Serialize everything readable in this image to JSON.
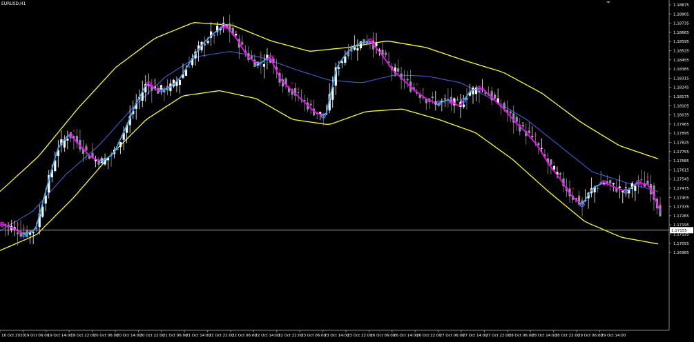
{
  "symbol": "EURUSD,H1",
  "current_price_label": "1.17155",
  "chart_data": {
    "type": "candlestick",
    "title": "EURUSD,H1",
    "timeframe": "H1",
    "y_ticks": [
      "1.18875",
      "1.18805",
      "1.18735",
      "1.18665",
      "1.18595",
      "1.18525",
      "1.18455",
      "1.18385",
      "1.18315",
      "1.18245",
      "1.18175",
      "1.18105",
      "1.18035",
      "1.17965",
      "1.17895",
      "1.17825",
      "1.17755",
      "1.17685",
      "1.17615",
      "1.17545",
      "1.17475",
      "1.17405",
      "1.17335",
      "1.17265",
      "1.17195",
      "1.17125",
      "1.17055",
      "1.16985"
    ],
    "x_ticks": [
      "16 Oct 2020",
      "19 Oct 06:00",
      "19 Oct 14:00",
      "19 Oct 22:00",
      "20 Oct 06:00",
      "20 Oct 14:00",
      "20 Oct 22:00",
      "21 Oct 06:00",
      "21 Oct 14:00",
      "21 Oct 22:00",
      "22 Oct 06:00",
      "22 Oct 14:00",
      "22 Oct 22:00",
      "23 Oct 06:00",
      "23 Oct 14:00",
      "23 Oct 22:00",
      "26 Oct 06:00",
      "26 Oct 14:00",
      "26 Oct 22:00",
      "27 Oct 06:00",
      "27 Oct 14:00",
      "27 Oct 22:00",
      "28 Oct 06:00",
      "28 Oct 14:00",
      "28 Oct 22:00",
      "29 Oct 06:00",
      "29 Oct 14:00"
    ],
    "ylim": [
      1.1695,
      1.189
    ],
    "current_price": 1.17155,
    "price_anchors": [
      1.172,
      1.1717,
      1.1712,
      1.1716,
      1.1748,
      1.1778,
      1.1789,
      1.178,
      1.1771,
      1.1768,
      1.1774,
      1.1792,
      1.1812,
      1.1828,
      1.1822,
      1.1824,
      1.1832,
      1.1846,
      1.1858,
      1.1866,
      1.1872,
      1.1862,
      1.1848,
      1.1842,
      1.1848,
      1.183,
      1.1822,
      1.1814,
      1.1806,
      1.1802,
      1.184,
      1.1852,
      1.1858,
      1.186,
      1.185,
      1.1838,
      1.183,
      1.1822,
      1.1816,
      1.1812,
      1.1815,
      1.181,
      1.1822,
      1.1824,
      1.1816,
      1.1808,
      1.1798,
      1.179,
      1.178,
      1.1766,
      1.1755,
      1.1742,
      1.1735,
      1.1748,
      1.1752,
      1.1748,
      1.1745,
      1.1752,
      1.175,
      1.173
    ],
    "middle_band": [
      1.1715,
      1.173,
      1.1758,
      1.178,
      1.1808,
      1.1832,
      1.1848,
      1.1852,
      1.1847,
      1.1838,
      1.183,
      1.1828,
      1.1834,
      1.1833,
      1.1828,
      1.1815,
      1.18,
      1.178,
      1.176,
      1.1752,
      1.1745
    ],
    "upper_band": [
      1.1745,
      1.1772,
      1.1808,
      1.184,
      1.1862,
      1.1874,
      1.1872,
      1.186,
      1.1852,
      1.1855,
      1.186,
      1.1855,
      1.1845,
      1.1836,
      1.182,
      1.1798,
      1.178,
      1.177
    ],
    "lower_band": [
      1.17,
      1.1712,
      1.174,
      1.1772,
      1.18,
      1.1818,
      1.1822,
      1.1816,
      1.18,
      1.1796,
      1.1806,
      1.1808,
      1.18,
      1.179,
      1.177,
      1.1745,
      1.1722,
      1.171,
      1.1705
    ]
  },
  "colors": {
    "background": "#000000",
    "text": "#ffffff",
    "axis": "#8a8a8a",
    "bull_candle": "#ffffff",
    "bear_candle": "#8a94a2",
    "band": "#ffff1a",
    "middle_band": "#3c5fd6",
    "trend_up": "#3aa0f0",
    "trend_down": "#ff00ff",
    "signal_marker": "#ff1a1a"
  }
}
